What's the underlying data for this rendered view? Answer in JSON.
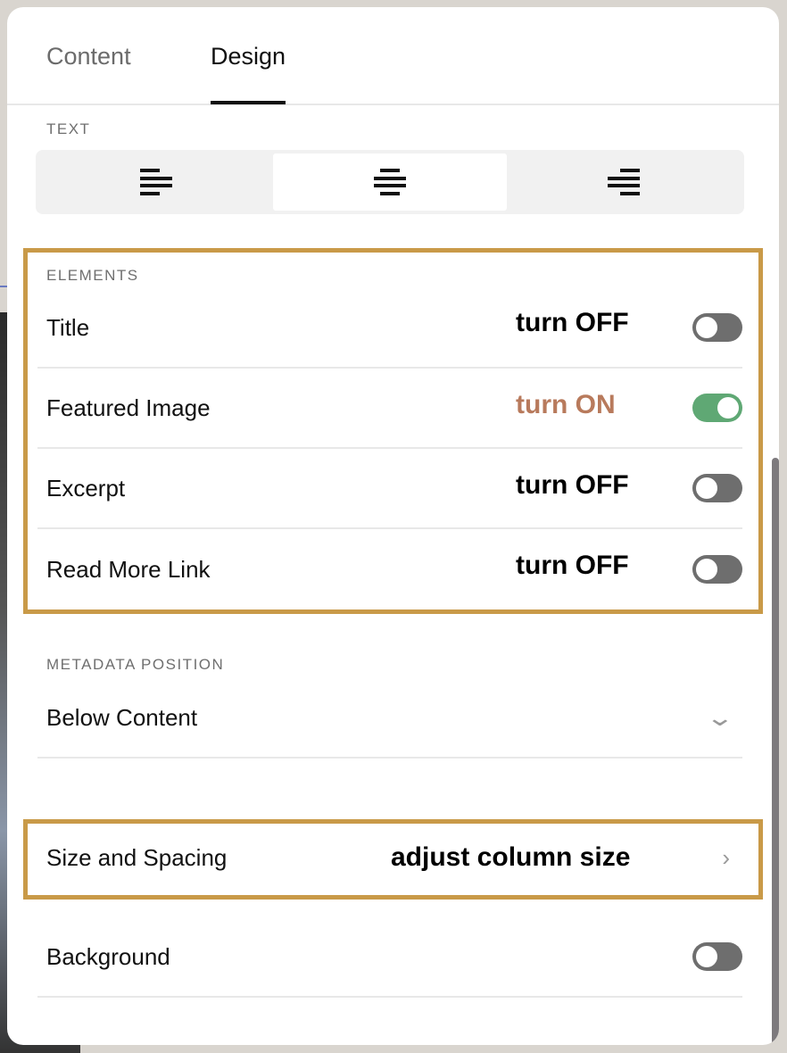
{
  "tabs": [
    {
      "label": "Content",
      "active": false
    },
    {
      "label": "Design",
      "active": true
    }
  ],
  "text_section": {
    "label": "TEXT",
    "alignment_options": [
      "align-left",
      "align-center",
      "align-right"
    ],
    "selected": "align-center"
  },
  "elements": {
    "label": "ELEMENTS",
    "items": [
      {
        "label": "Title",
        "annotation": "turn OFF",
        "on": false
      },
      {
        "label": "Featured Image",
        "annotation": "turn ON",
        "on": true
      },
      {
        "label": "Excerpt",
        "annotation": "turn OFF",
        "on": false
      },
      {
        "label": "Read More Link",
        "annotation": "turn OFF",
        "on": false
      }
    ]
  },
  "metadata": {
    "label": "METADATA POSITION",
    "value": "Below Content"
  },
  "size_spacing": {
    "label": "Size and Spacing",
    "annotation": "adjust column size"
  },
  "background": {
    "label": "Background",
    "on": false
  },
  "colors": {
    "highlight": "#c99a48",
    "toggle_on": "#5fa874",
    "toggle_off": "#6e6e6e",
    "annotation_on": "#b87a5c"
  }
}
